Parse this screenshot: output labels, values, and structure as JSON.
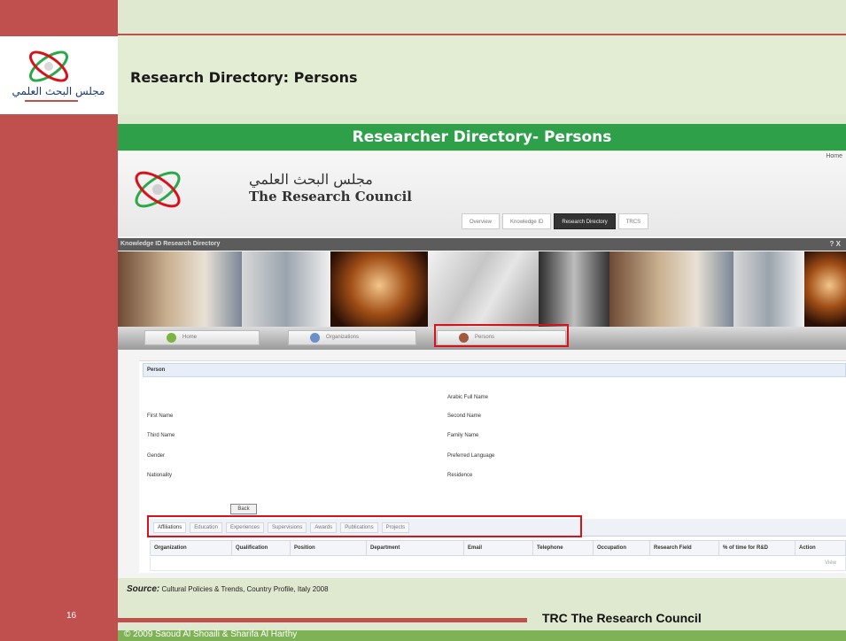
{
  "slide": {
    "title": "Research Directory: Persons",
    "header": "Researcher Directory- Persons",
    "source_label": "Source:",
    "source_text": "Cultural Policies & Trends, Country Profile, Italy 2008",
    "page_number": "16",
    "footer_brand": "TRC The Research Council",
    "copyright": "© 2009 Saoud Al Shoaili & Sharifa Al Harthy"
  },
  "app": {
    "home_link": "Home",
    "org_name_arabic": "مجلس البحث العلمي",
    "org_name": "The Research Council",
    "nav_tabs": [
      "Overview",
      "Knowledge ID",
      "Research Directory",
      "TRCS"
    ],
    "active_nav": "Research Directory",
    "directory_bar": "Knowledge ID Research Directory",
    "directory_bar_icons": "? X",
    "menu": {
      "home": "Home",
      "organizations": "Organizations",
      "persons": "Persons"
    },
    "form": {
      "section_title": "Person",
      "fields": {
        "arabic_full_name": "Arabic Full Name",
        "first_name": "First Name",
        "second_name": "Second Name",
        "third_name": "Third Name",
        "family_name": "Family Name",
        "gender": "Gender",
        "preferred_language": "Preferred Language",
        "nationality": "Nationality",
        "residence": "Residence"
      },
      "back_button": "Back"
    },
    "subtabs": [
      "Affiliations",
      "Education",
      "Experiences",
      "Supervisions",
      "Awards",
      "Publications",
      "Projects"
    ],
    "active_subtab": "Affiliations",
    "grid_columns": [
      "Organization",
      "Qualification",
      "Position",
      "Department",
      "Email",
      "Telephone",
      "Occupation",
      "Research Field",
      "% of time for R&D",
      "Action"
    ],
    "grid_row_action": "View"
  },
  "colors": {
    "sidebar": "#c0504d",
    "header_green": "#2ea04a",
    "highlight_red": "#d8111a",
    "slide_background": "#dfe9cf"
  }
}
